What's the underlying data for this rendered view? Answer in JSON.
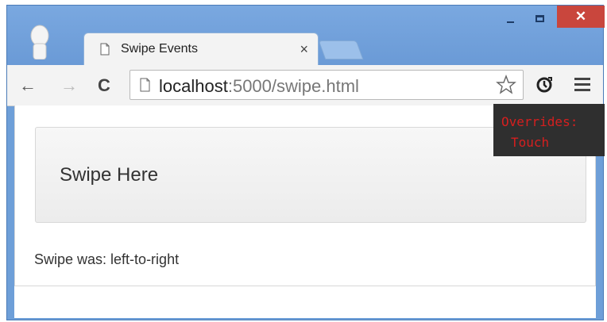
{
  "window": {
    "close_glyph": "✕"
  },
  "tab": {
    "title": "Swipe Events",
    "close_glyph": "×"
  },
  "toolbar": {
    "back_glyph": "←",
    "forward_glyph": "→",
    "reload_glyph": "C",
    "url_host": "localhost",
    "url_rest": ":5000/swipe.html"
  },
  "page": {
    "swipe_area_label": "Swipe Here",
    "result_prefix": "Swipe was: ",
    "result_value": "left-to-right"
  },
  "devtools_overlay": {
    "line1": "Overrides:",
    "line2": "Touch",
    "color": "#d61f1f"
  },
  "icons": [
    "user-avatar-icon",
    "document-icon",
    "star-icon",
    "extension-icon",
    "menu-icon"
  ]
}
